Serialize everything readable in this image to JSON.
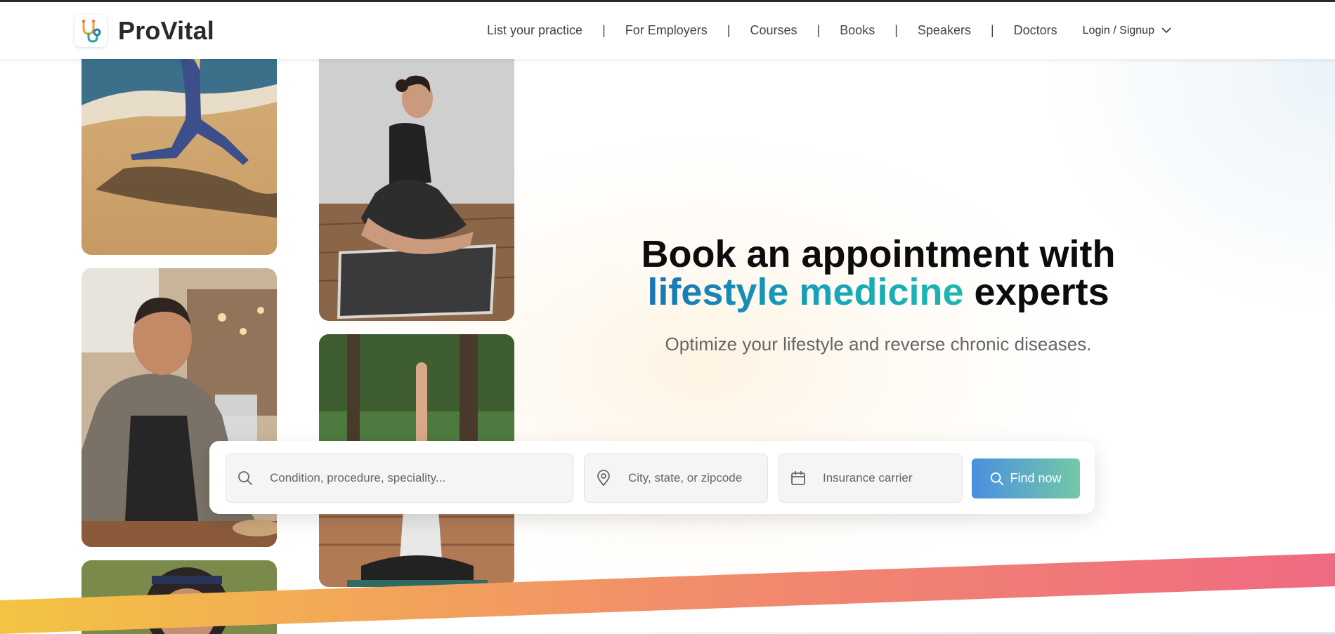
{
  "brand": {
    "name": "ProVital"
  },
  "nav": {
    "links": [
      "List your practice",
      "For Employers",
      "Courses",
      "Books",
      "Speakers",
      "Doctors"
    ],
    "separator": "|",
    "login_label": "Login / Signup"
  },
  "hero": {
    "title_line1": "Book an appointment with",
    "title_highlight": "lifestyle medicine",
    "title_end": " experts",
    "subtitle": "Optimize your lifestyle and reverse chronic diseases."
  },
  "search": {
    "condition_placeholder": "Condition, procedure, speciality...",
    "location_placeholder": "City, state, or zipcode",
    "insurance_placeholder": "Insurance carrier",
    "button_label": "Find now"
  },
  "colors": {
    "accent_blue": "#1874b4",
    "accent_teal": "#1bb8ae",
    "ribbon_start": "#f3c443",
    "ribbon_end": "#ef6a83",
    "button_start": "#4a8fe0",
    "button_end": "#73c9a6"
  },
  "icons": [
    "stethoscope-logo-icon",
    "chevron-down-icon",
    "search-icon",
    "location-pin-icon",
    "calendar-icon"
  ]
}
